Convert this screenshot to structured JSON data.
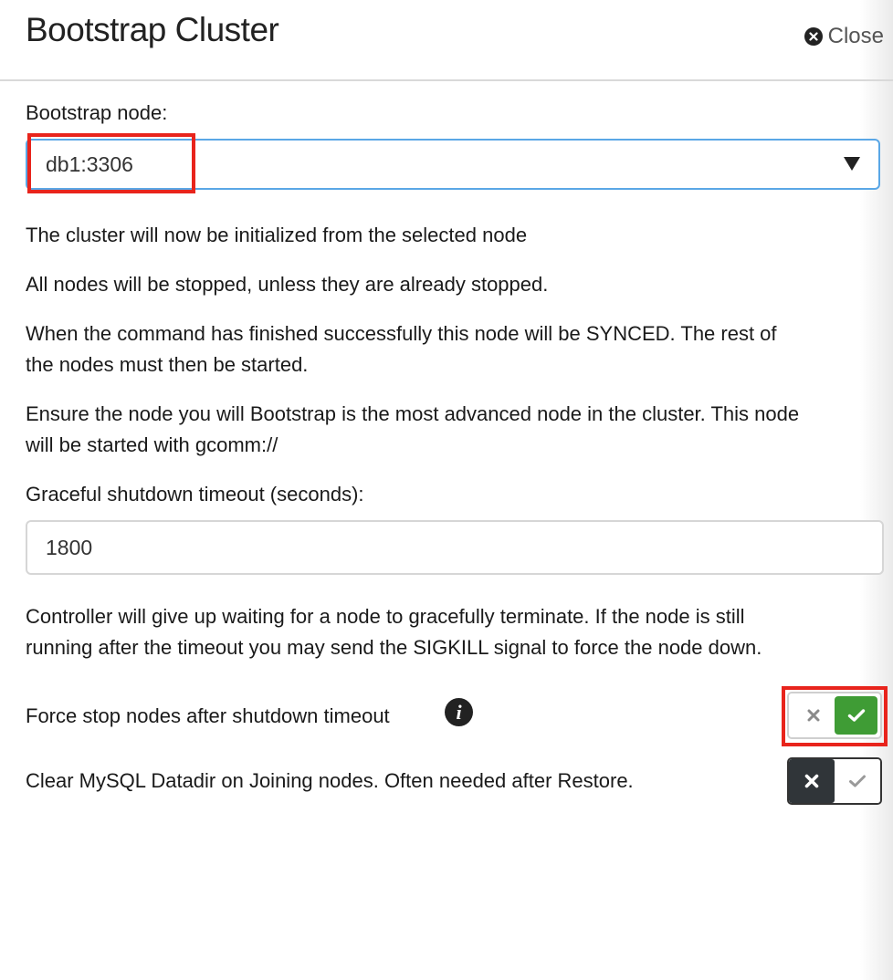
{
  "dialog": {
    "title": "Bootstrap Cluster",
    "close_label": "Close"
  },
  "bootstrap": {
    "label": "Bootstrap node:",
    "selected_node": "db1:3306"
  },
  "info": {
    "line1": "The cluster will now be initialized from the selected node",
    "line2": "All nodes will be stopped, unless they are already stopped.",
    "line3a": "When the command has finished successfully this node will be SYNCED. The rest of",
    "line3b": "the nodes must then be started.",
    "line4a": "Ensure the node you will Bootstrap is the most advanced node in the cluster. This node",
    "line4b": "will be started with gcomm://"
  },
  "timeout": {
    "label": "Graceful shutdown timeout (seconds):",
    "value": "1800",
    "help_a": "Controller will give up waiting for a node to gracefully terminate. If the node is still",
    "help_b": "running after the timeout you may send the SIGKILL signal to force the node down."
  },
  "options": {
    "force_stop": {
      "label": "Force stop nodes after shutdown timeout",
      "enabled": true
    },
    "clear_datadir": {
      "label": "Clear MySQL Datadir on Joining nodes. Often needed after Restore.",
      "enabled": false
    }
  },
  "colors": {
    "toggle_on": "#3f9c35",
    "toggle_off_dark": "#303539",
    "select_focus": "#5aa7e6",
    "highlight_red": "#e8241c"
  },
  "icons": {
    "close": "close-circle-icon",
    "dropdown": "caret-down-icon",
    "info": "info-icon",
    "off": "x-icon",
    "on": "check-icon"
  }
}
